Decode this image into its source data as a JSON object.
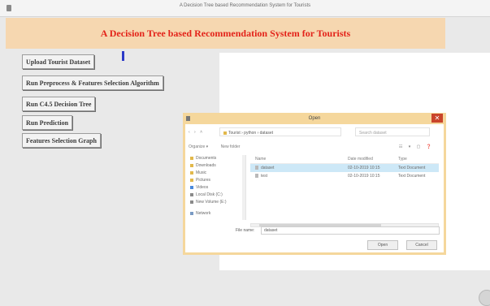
{
  "window": {
    "title": "A Decision Tree based Recommendation System for Tourists"
  },
  "header": {
    "title": "A Decision Tree based Recommendation System for Tourists"
  },
  "buttons": {
    "upload": "Upload Tourist Dataset",
    "preprocess": "Run Preprocess & Features Selection Algorithm",
    "c45": "Run C4.5 Decision Tree",
    "predict": "Run Prediction",
    "graph": "Features Selection Graph"
  },
  "dialog": {
    "title": "Open",
    "close_label": "✕",
    "nav_arrows": "‹ › ˄",
    "breadcrumb": "Tourist › python › dataset",
    "search_placeholder": "Search dataset",
    "organize_label": "Organize ▾",
    "new_folder_label": "New folder",
    "view_icons": "☷ ▾ ▢ ❓",
    "nav_items": [
      {
        "label": "Documents",
        "color": "#e2b84b"
      },
      {
        "label": "Downloads",
        "color": "#e2b84b"
      },
      {
        "label": "Music",
        "color": "#e2b84b"
      },
      {
        "label": "Pictures",
        "color": "#e2b84b"
      },
      {
        "label": "Videos",
        "color": "#4a89dc"
      },
      {
        "label": "Local Disk (C:)",
        "color": "#8a8a8a"
      },
      {
        "label": "New Volume (E:)",
        "color": "#8a8a8a"
      }
    ],
    "network_label": "Network",
    "columns": {
      "name": "Name",
      "date": "Date modified",
      "type": "Type"
    },
    "files": [
      {
        "name": "dataset",
        "date": "02-10-2019 10:15",
        "type": "Text Document",
        "selected": true
      },
      {
        "name": "test",
        "date": "02-10-2019 10:15",
        "type": "Text Document",
        "selected": false
      }
    ],
    "filename_label": "File name:",
    "filename_value": "dataset",
    "open_label": "Open",
    "cancel_label": "Cancel"
  }
}
